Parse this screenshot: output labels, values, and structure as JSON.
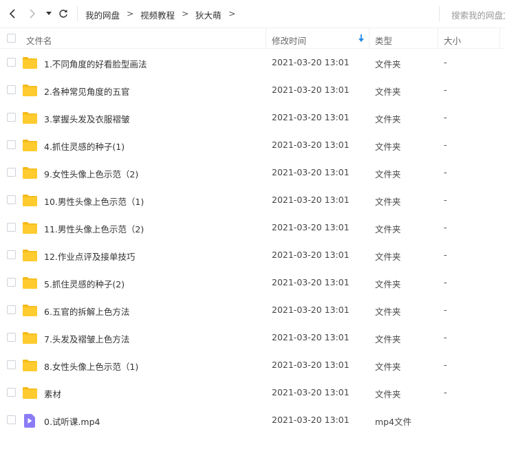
{
  "colors": {
    "folder": "#ffcb2e",
    "folder_back": "#f5b916",
    "video_icon": "#8b7cf6",
    "sort_arrow": "#1e88e5"
  },
  "toolbar": {
    "breadcrumb": [
      "我的网盘",
      "视频教程",
      "狄大萌"
    ],
    "separator": ">",
    "search_placeholder": "搜索我的网盘文件"
  },
  "header": {
    "name": "文件名",
    "mtime": "修改时间",
    "type": "类型",
    "size": "大小",
    "sort_indicator": "arrow-down-icon"
  },
  "files": [
    {
      "icon": "folder-icon",
      "name": "1.不同角度的好看脸型画法",
      "mtime": "2021-03-20 13:01",
      "type": "文件夹",
      "size": "-"
    },
    {
      "icon": "folder-icon",
      "name": "2.各种常见角度的五官",
      "mtime": "2021-03-20 13:01",
      "type": "文件夹",
      "size": "-"
    },
    {
      "icon": "folder-icon",
      "name": "3.掌握头发及衣服褶皱",
      "mtime": "2021-03-20 13:01",
      "type": "文件夹",
      "size": "-"
    },
    {
      "icon": "folder-icon",
      "name": "4.抓住灵感的种子(1)",
      "mtime": "2021-03-20 13:01",
      "type": "文件夹",
      "size": "-"
    },
    {
      "icon": "folder-icon",
      "name": "9.女性头像上色示范（2)",
      "mtime": "2021-03-20 13:01",
      "type": "文件夹",
      "size": "-"
    },
    {
      "icon": "folder-icon",
      "name": "10.男性头像上色示范（1)",
      "mtime": "2021-03-20 13:01",
      "type": "文件夹",
      "size": "-"
    },
    {
      "icon": "folder-icon",
      "name": "11.男性头像上色示范（2)",
      "mtime": "2021-03-20 13:01",
      "type": "文件夹",
      "size": "-"
    },
    {
      "icon": "folder-icon",
      "name": "12.作业点评及接单技巧",
      "mtime": "2021-03-20 13:01",
      "type": "文件夹",
      "size": "-"
    },
    {
      "icon": "folder-icon",
      "name": "5.抓住灵感的种子(2)",
      "mtime": "2021-03-20 13:01",
      "type": "文件夹",
      "size": "-"
    },
    {
      "icon": "folder-icon",
      "name": "6.五官的拆解上色方法",
      "mtime": "2021-03-20 13:01",
      "type": "文件夹",
      "size": "-"
    },
    {
      "icon": "folder-icon",
      "name": "7.头发及褶皱上色方法",
      "mtime": "2021-03-20 13:01",
      "type": "文件夹",
      "size": "-"
    },
    {
      "icon": "folder-icon",
      "name": "8.女性头像上色示范（1)",
      "mtime": "2021-03-20 13:01",
      "type": "文件夹",
      "size": "-"
    },
    {
      "icon": "folder-icon",
      "name": "素材",
      "mtime": "2021-03-20 13:01",
      "type": "文件夹",
      "size": "-"
    },
    {
      "icon": "video-file-icon",
      "name": "0.试听课.mp4",
      "mtime": "2021-03-20 13:01",
      "type": "mp4文件",
      "size": ""
    }
  ]
}
